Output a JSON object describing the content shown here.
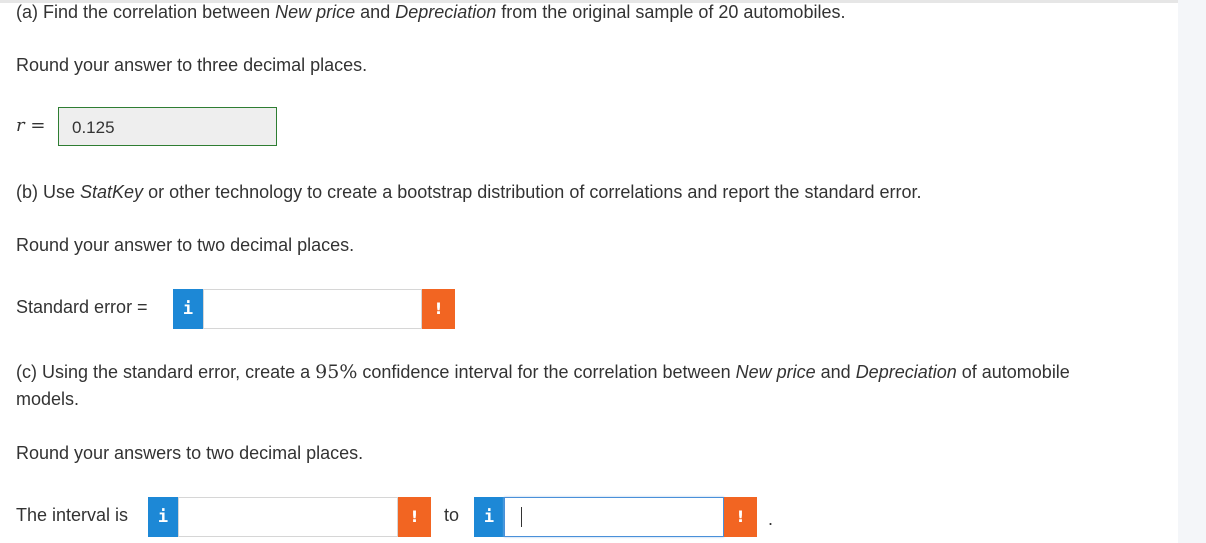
{
  "part_a": {
    "prefix": "(a) Find the correlation between ",
    "var1": "New price",
    "middle": " and ",
    "var2": "Depreciation",
    "suffix": " from the original sample of 20 automobiles.",
    "rounding": "Round your answer to three decimal places.",
    "answer_label": "r =",
    "answer_value": "0.125"
  },
  "part_b": {
    "prefix": "(b) Use ",
    "tool": "StatKey",
    "suffix": " or other technology to create a bootstrap distribution of correlations and report the standard error.",
    "rounding": "Round your answer to two decimal places.",
    "answer_label": "Standard error =",
    "answer_value": ""
  },
  "part_c": {
    "prefix": "(c) Using the standard error, create a ",
    "confidence": "95%",
    "middle": " confidence interval for the correlation between ",
    "var1": "New price",
    "and": " and ",
    "var2": "Depreciation",
    "suffix": " of automobile",
    "line2": "models.",
    "rounding": "Round your answers to two decimal places.",
    "answer_label": "The interval is",
    "to_word": "to",
    "lower_value": "",
    "upper_value": "",
    "end_period": "."
  },
  "icons": {
    "info_glyph": "i",
    "warning_glyph": "!"
  },
  "colors": {
    "info": "#1d88d6",
    "warning": "#f26522",
    "correct_border": "#2e7d32",
    "focus_border": "#4a90d9"
  }
}
